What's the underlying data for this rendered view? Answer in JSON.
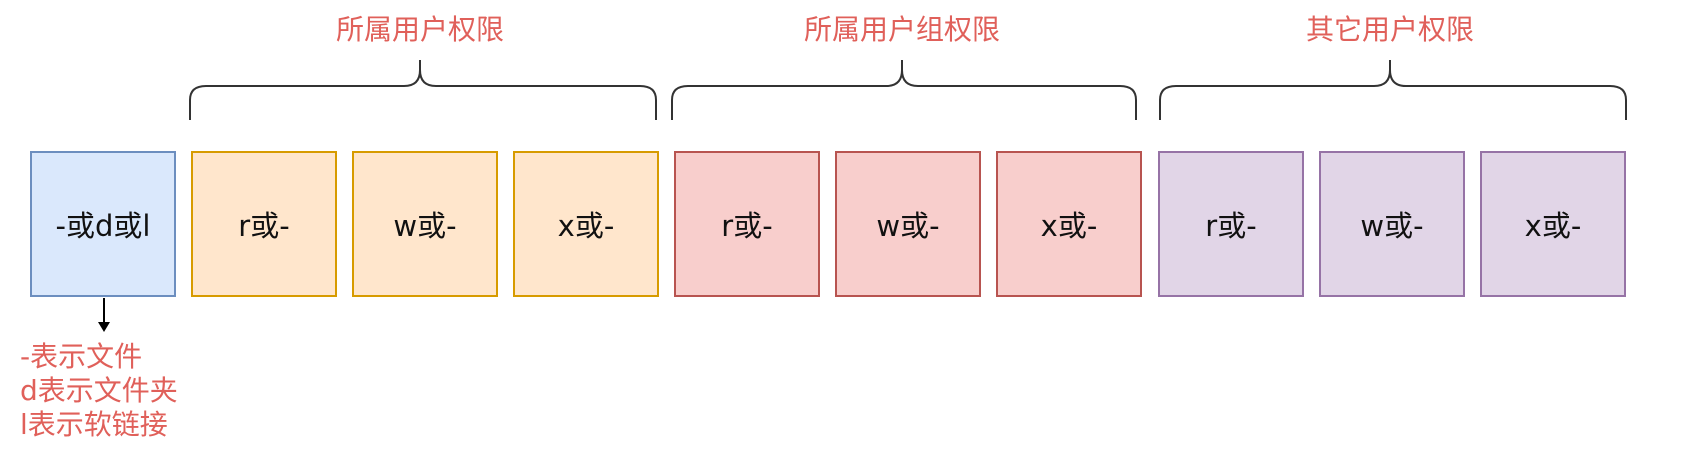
{
  "type_box": {
    "label": "-或d或l"
  },
  "groups": [
    {
      "title": "所属用户权限",
      "boxes": [
        "r或-",
        "w或-",
        "x或-"
      ]
    },
    {
      "title": "所属用户组权限",
      "boxes": [
        "r或-",
        "w或-",
        "x或-"
      ]
    },
    {
      "title": "其它用户权限",
      "boxes": [
        "r或-",
        "w或-",
        "x或-"
      ]
    }
  ],
  "note": {
    "lines": [
      "-表示文件",
      "d表示文件夹",
      "l表示软链接"
    ]
  },
  "colors": {
    "type_fill": "#dae8fc",
    "owner_fill": "#ffe6cc",
    "group_fill": "#f8cecc",
    "other_fill": "#e1d5e7",
    "annotation_text": "#e0605a"
  }
}
